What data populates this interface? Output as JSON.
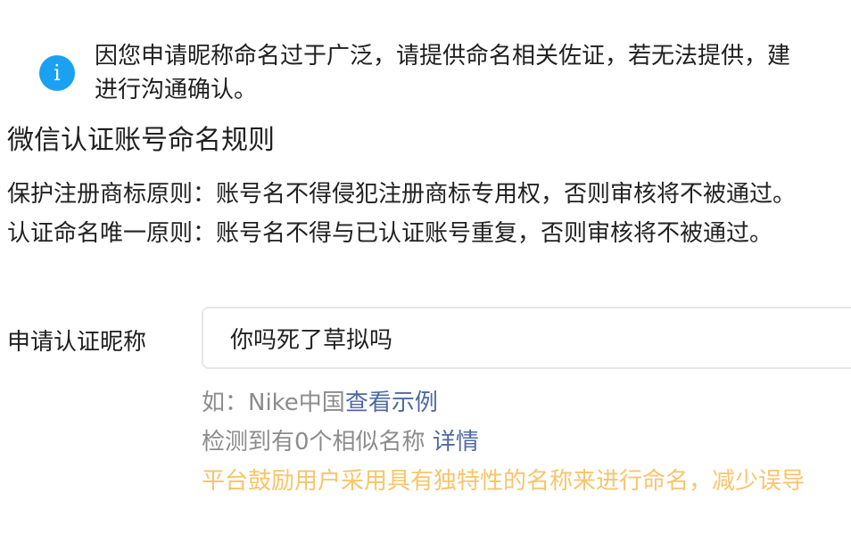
{
  "notice": {
    "line1": "因您申请昵称命名过于广泛，请提供命名相关佐证，若无法提供，建",
    "line2": "进行沟通确认。",
    "icon": "info-icon",
    "icon_glyph": "i"
  },
  "section": {
    "title": "微信认证账号命名规则"
  },
  "rules": [
    "保护注册商标原则：账号名不得侵犯注册商标专用权，否则审核将不被通过。",
    "认证命名唯一原则：账号名不得与已认证账号重复，否则审核将不被通过。"
  ],
  "form": {
    "label": "申请认证昵称",
    "input_value": "你吗死了草拟吗"
  },
  "hints": {
    "example_prefix": "如：Nike中国",
    "example_link": "查看示例",
    "similar_text": "检测到有0个相似名称",
    "details_link": "详情",
    "encourage_text": "平台鼓励用户采用具有独特性的名称来进行命名，减少误导"
  },
  "colors": {
    "accent_blue": "#1aa1f1",
    "link": "#4f6aa1",
    "warning": "#f9c46b",
    "muted": "#8c8c8c"
  }
}
